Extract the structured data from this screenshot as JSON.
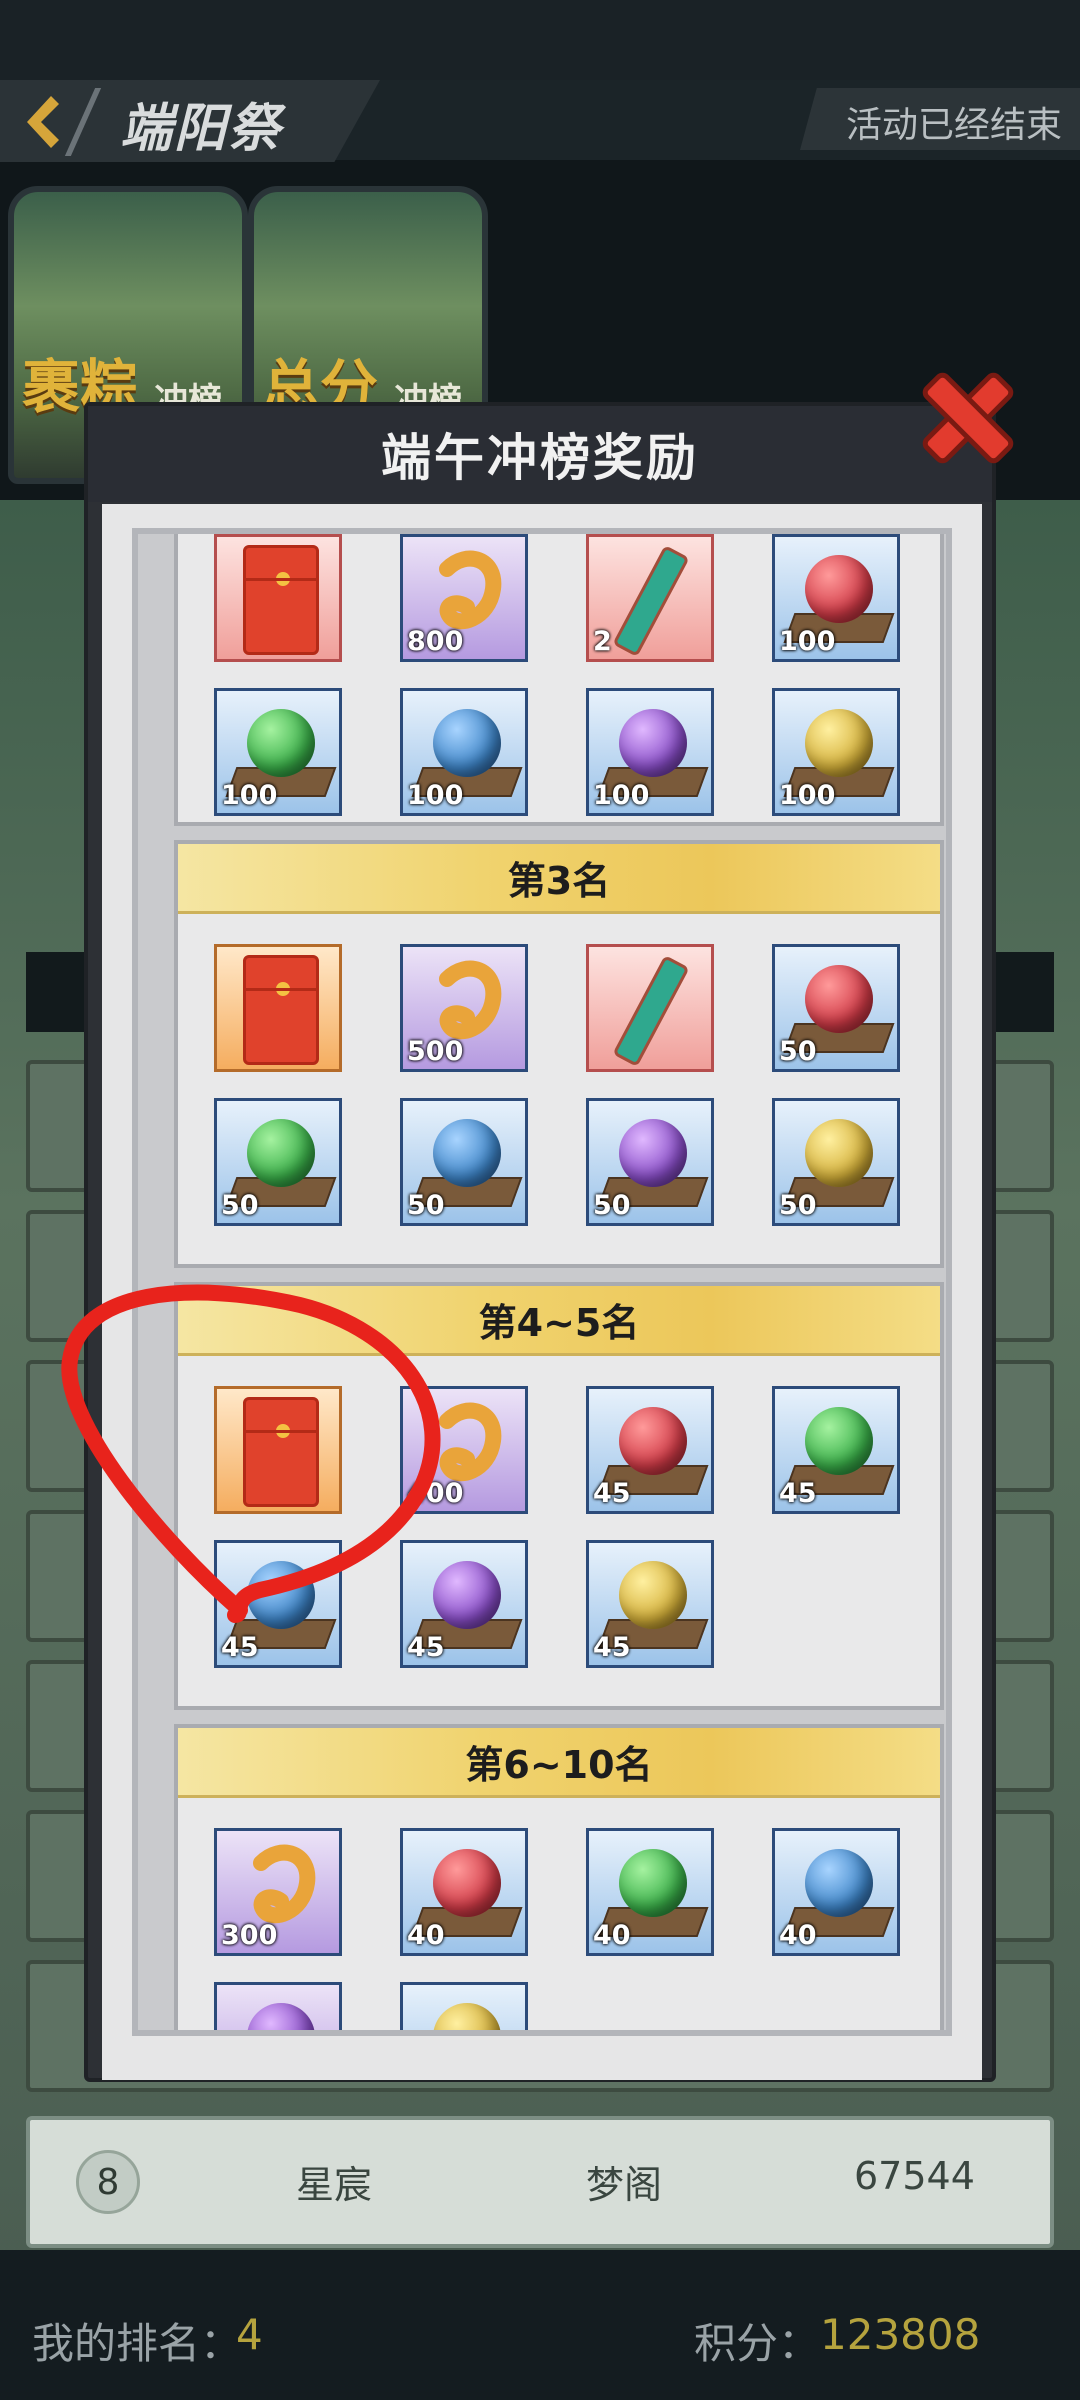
{
  "header": {
    "title": "端阳祭",
    "status": "活动已经结束"
  },
  "tabs": [
    {
      "label": "裹粽",
      "sub": "冲榜"
    },
    {
      "label": "总分",
      "sub": "冲榜"
    }
  ],
  "modal": {
    "title": "端午冲榜奖励",
    "sections": [
      {
        "title": "",
        "rows": [
          [
            {
              "icon": "red-envelope-icon",
              "qty": "",
              "bg": "pink"
            },
            {
              "icon": "golden-hook-icon",
              "qty": "800",
              "bg": "purple"
            },
            {
              "icon": "scroll-icon",
              "qty": "2",
              "bg": "pink"
            },
            {
              "icon": "red-orb-icon",
              "qty": "100",
              "bg": "blue"
            }
          ],
          [
            {
              "icon": "green-orb-icon",
              "qty": "100",
              "bg": "blue"
            },
            {
              "icon": "blue-orb-icon",
              "qty": "100",
              "bg": "blue"
            },
            {
              "icon": "purple-orb-icon",
              "qty": "100",
              "bg": "blue"
            },
            {
              "icon": "gold-orb-icon",
              "qty": "100",
              "bg": "blue"
            }
          ]
        ]
      },
      {
        "title": "第3名",
        "rows": [
          [
            {
              "icon": "red-envelope-icon",
              "qty": "",
              "bg": "orange"
            },
            {
              "icon": "golden-hook-icon",
              "qty": "500",
              "bg": "purple"
            },
            {
              "icon": "scroll-icon",
              "qty": "",
              "bg": "pink"
            },
            {
              "icon": "red-orb-icon",
              "qty": "50",
              "bg": "blue"
            }
          ],
          [
            {
              "icon": "green-orb-icon",
              "qty": "50",
              "bg": "blue"
            },
            {
              "icon": "blue-orb-icon",
              "qty": "50",
              "bg": "blue"
            },
            {
              "icon": "purple-orb-icon",
              "qty": "50",
              "bg": "blue"
            },
            {
              "icon": "gold-orb-icon",
              "qty": "50",
              "bg": "blue"
            }
          ]
        ]
      },
      {
        "title": "第4~5名",
        "rows": [
          [
            {
              "icon": "red-envelope-icon",
              "qty": "",
              "bg": "orange"
            },
            {
              "icon": "golden-hook-icon",
              "qty": "400",
              "bg": "purple"
            },
            {
              "icon": "red-orb-icon",
              "qty": "45",
              "bg": "blue"
            },
            {
              "icon": "green-orb-icon",
              "qty": "45",
              "bg": "blue"
            }
          ],
          [
            {
              "icon": "blue-orb-icon",
              "qty": "45",
              "bg": "blue"
            },
            {
              "icon": "purple-orb-icon",
              "qty": "45",
              "bg": "blue"
            },
            {
              "icon": "gold-orb-icon",
              "qty": "45",
              "bg": "blue"
            }
          ]
        ]
      },
      {
        "title": "第6~10名",
        "rows": [
          [
            {
              "icon": "golden-hook-icon",
              "qty": "300",
              "bg": "purple"
            },
            {
              "icon": "red-orb-icon",
              "qty": "40",
              "bg": "blue"
            },
            {
              "icon": "green-orb-icon",
              "qty": "40",
              "bg": "blue"
            },
            {
              "icon": "blue-orb-icon",
              "qty": "40",
              "bg": "blue"
            }
          ],
          [
            {
              "icon": "purple-orb-icon",
              "qty": "",
              "bg": "purple"
            },
            {
              "icon": "gold-orb-icon",
              "qty": "",
              "bg": "blue"
            }
          ]
        ]
      }
    ]
  },
  "leaderboard_row": {
    "rank": "8",
    "name": "星宸",
    "guild": "梦阁",
    "score": "67544"
  },
  "footer": {
    "rank_label": "我的排名：",
    "rank_value": "4",
    "score_label": "积分：",
    "score_value": "123808"
  },
  "colors": {
    "accent_gold": "#b5a33e",
    "section_header": "#f0d36e",
    "annotation_red": "#e8231c",
    "close_red": "#e23b2e"
  }
}
